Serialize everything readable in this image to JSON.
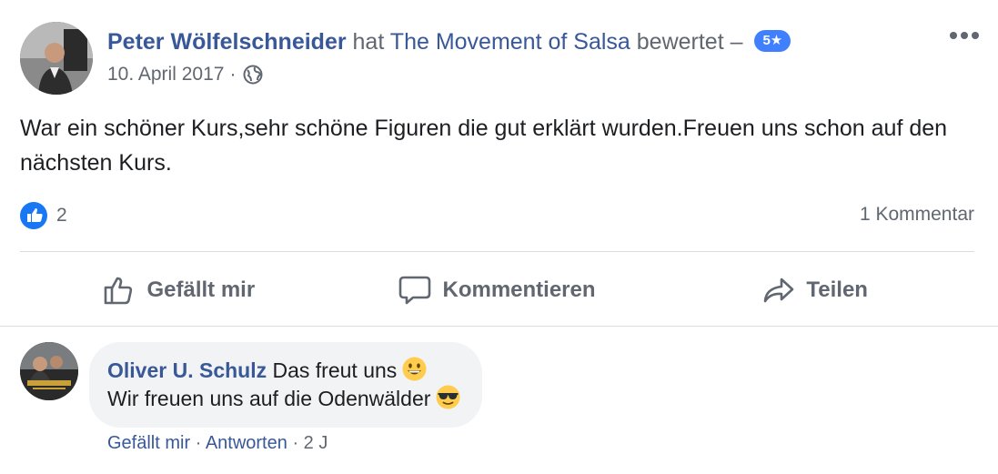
{
  "post": {
    "author": "Peter Wölfelschneider",
    "action_prefix": "hat",
    "page_name": "The Movement of Salsa",
    "action_suffix": "bewertet –",
    "rating": "5★",
    "date": "10. April 2017",
    "meta_separator": "·",
    "text": "War ein schöner Kurs,sehr schöne Figuren die gut erklärt wurden.Freuen uns schon auf den nächsten Kurs.",
    "like_count": "2",
    "comment_count": "1 Kommentar"
  },
  "actions": {
    "like": "Gefällt mir",
    "comment": "Kommentieren",
    "share": "Teilen"
  },
  "comment": {
    "author": "Oliver U. Schulz",
    "line1": "Das freut uns",
    "line2": "Wir freuen uns auf die Odenwälder",
    "like_link": "Gefällt mir",
    "reply_link": "Antworten",
    "separator": "·",
    "age": "2 J"
  },
  "colors": {
    "link": "#385898",
    "secondary_text": "#606770",
    "rating_badge": "#4080ff",
    "like_blue": "#1877f2",
    "bubble_bg": "#f2f3f5"
  },
  "icons": [
    "more-icon",
    "globe-icon",
    "like-reaction-icon",
    "thumbs-up-icon",
    "comment-icon",
    "share-icon",
    "grinning-emoji",
    "sunglasses-emoji"
  ]
}
